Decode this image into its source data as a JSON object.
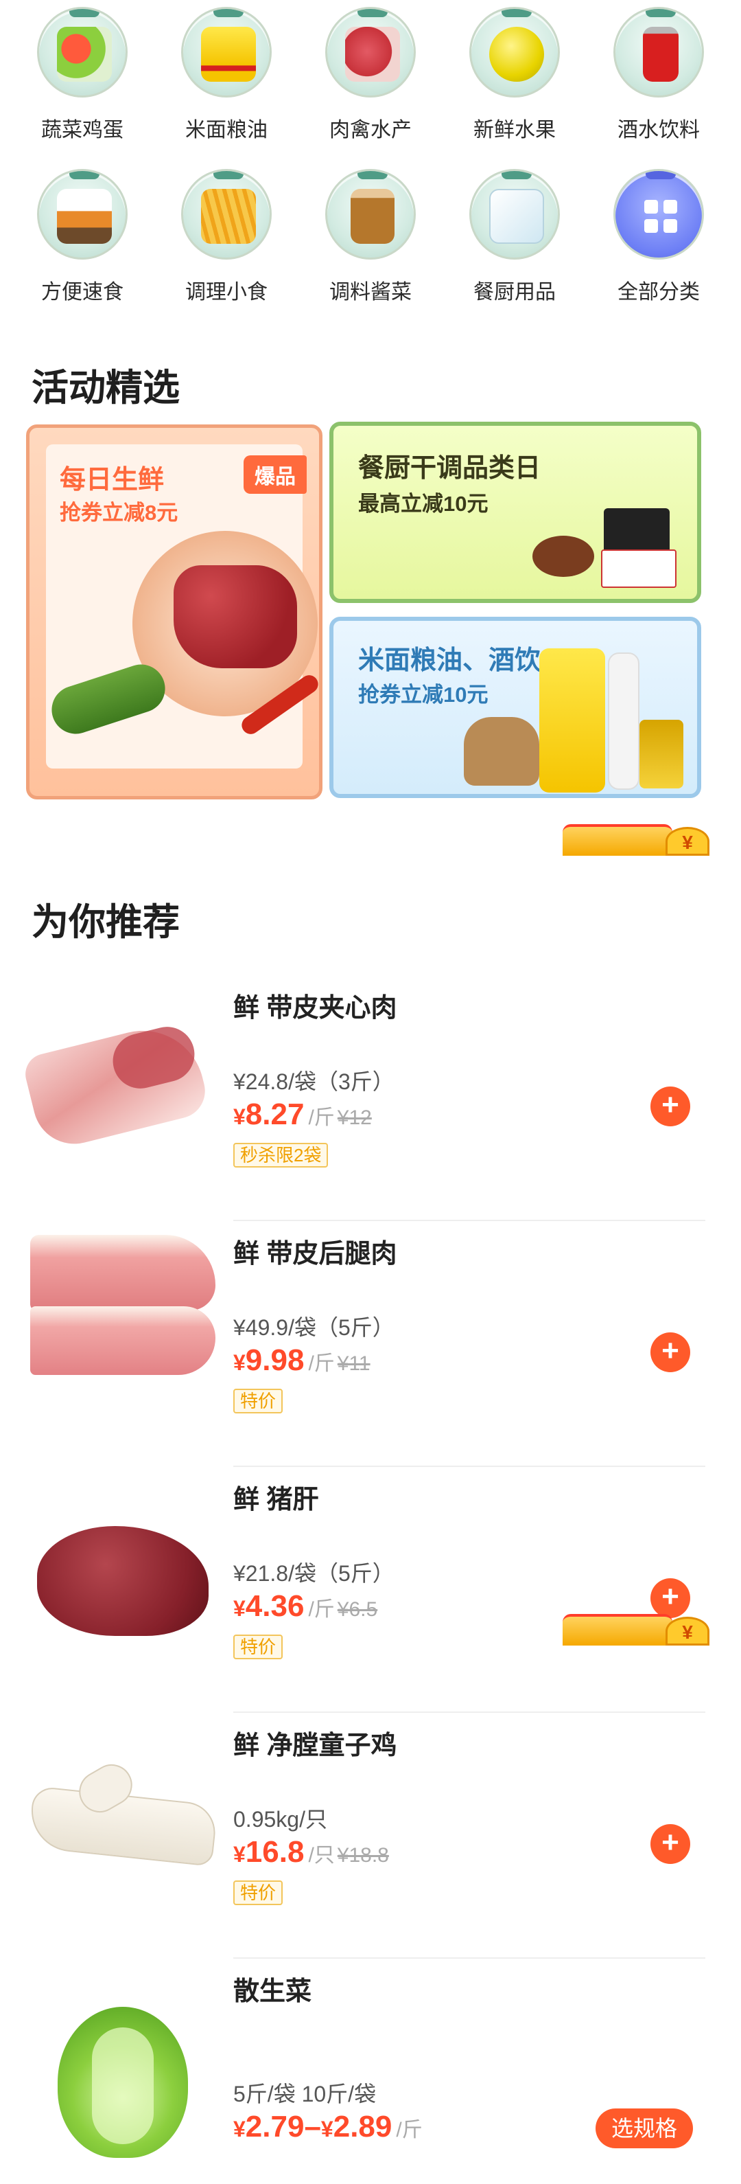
{
  "categories": [
    {
      "label": "蔬菜鸡蛋",
      "icon": "vegetables-eggs-icon",
      "color": "#e23b2e"
    },
    {
      "label": "米面粮油",
      "icon": "rice-oil-icon",
      "color": "#f5c400"
    },
    {
      "label": "肉禽水产",
      "icon": "meat-poultry-seafood-icon",
      "color": "#c8323a"
    },
    {
      "label": "新鲜水果",
      "icon": "fresh-fruit-icon",
      "color": "#e8d400"
    },
    {
      "label": "酒水饮料",
      "icon": "drinks-icon",
      "color": "#d81f1f"
    },
    {
      "label": "方便速食",
      "icon": "instant-food-icon",
      "color": "#e88a2a"
    },
    {
      "label": "调理小食",
      "icon": "snack-fries-icon",
      "color": "#f0a41a"
    },
    {
      "label": "调料酱菜",
      "icon": "seasoning-jar-icon",
      "color": "#b5772c"
    },
    {
      "label": "餐厨用品",
      "icon": "kitchen-supplies-icon",
      "color": "#cfe7f2"
    },
    {
      "label": "全部分类",
      "icon": "all-categories-icon",
      "color": "#6d7ff5"
    }
  ],
  "activity": {
    "title": "活动精选",
    "left": {
      "title": "每日生鲜",
      "subtitle": "抢券立减8元",
      "badge": "爆品"
    },
    "right_top": {
      "title": "餐厨干调品类日",
      "subtitle": "最高立减10元"
    },
    "right_bottom": {
      "title": "米面粮油、酒饮",
      "subtitle": "抢券立减10元"
    }
  },
  "recommend": {
    "title": "为你推荐",
    "products": [
      {
        "name": "鲜 带皮夹心肉",
        "spec": "¥24.8/袋（3斤）",
        "currency": "¥",
        "price": "8.27",
        "unit": "/斤",
        "orig": "¥12",
        "tag": "秒杀限2袋",
        "action": "+"
      },
      {
        "name": "鲜 带皮后腿肉",
        "spec": "¥49.9/袋（5斤）",
        "currency": "¥",
        "price": "9.98",
        "unit": "/斤",
        "orig": "¥11",
        "tag": "特价",
        "action": "+"
      },
      {
        "name": "鲜 猪肝",
        "spec": "¥21.8/袋（5斤）",
        "currency": "¥",
        "price": "4.36",
        "unit": "/斤",
        "orig": "¥6.5",
        "tag": "特价",
        "action": "+"
      },
      {
        "name": "鲜 净膛童子鸡",
        "spec": "0.95kg/只",
        "currency": "¥",
        "price": "16.8",
        "unit": "/只",
        "orig": "¥18.8",
        "tag": "特价",
        "action": "+"
      },
      {
        "name": "散生菜",
        "spec": "5斤/袋 10斤/袋",
        "currency": "¥",
        "price": "2.79",
        "price2": "2.89",
        "range_sep": "–",
        "unit": "/斤",
        "action": "选规格"
      }
    ]
  },
  "coupon_float": {
    "symbol": "¥"
  }
}
